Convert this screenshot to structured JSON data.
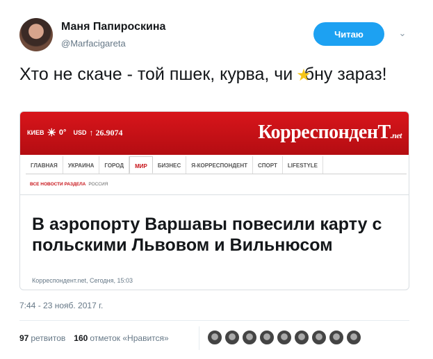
{
  "user": {
    "name": "Маня Папироскина",
    "handle": "@Marfacigareta",
    "follow_label": "Читаю",
    "chevron_icon": "chevron-down-icon"
  },
  "tweet": {
    "text_before": "Хто не скаче - той пшек, курва, чи ",
    "emoji": "★",
    "text_after": "бну зараз!"
  },
  "card": {
    "weather_city": "КИЕВ",
    "weather_temp": "0°",
    "currency": "USD",
    "rate": "↑ 26.9074",
    "logo_main": "КорреспонденТ",
    "logo_suffix": ".net",
    "nav": [
      "ГЛАВНАЯ",
      "УКРАИНА",
      "ГОРОД",
      "МИР",
      "БИЗНЕС",
      "Я-КОРРЕСПОНДЕНТ",
      "СПОРТ",
      "LIFESTYLE"
    ],
    "nav_active": "МИР",
    "subnav_link": "ВСЕ НОВОСТИ РАЗДЕЛА",
    "subnav_section": "РОССИЯ",
    "headline": "В аэропорту Варшавы повесили карту с польскими Львовом и Вильнюсом",
    "source": "Корреспондент.net, Сегодня, 15:03",
    "accent_color": "#c8141a"
  },
  "timestamp": "7:44 - 23 нояб. 2017 г.",
  "stats": {
    "retweets_count": "97",
    "retweets_label": "ретвитов",
    "likes_count": "160",
    "likes_label": "отметок «Нравится»"
  },
  "colors": {
    "follow_button": "#1da1f2",
    "muted_text": "#657786"
  }
}
